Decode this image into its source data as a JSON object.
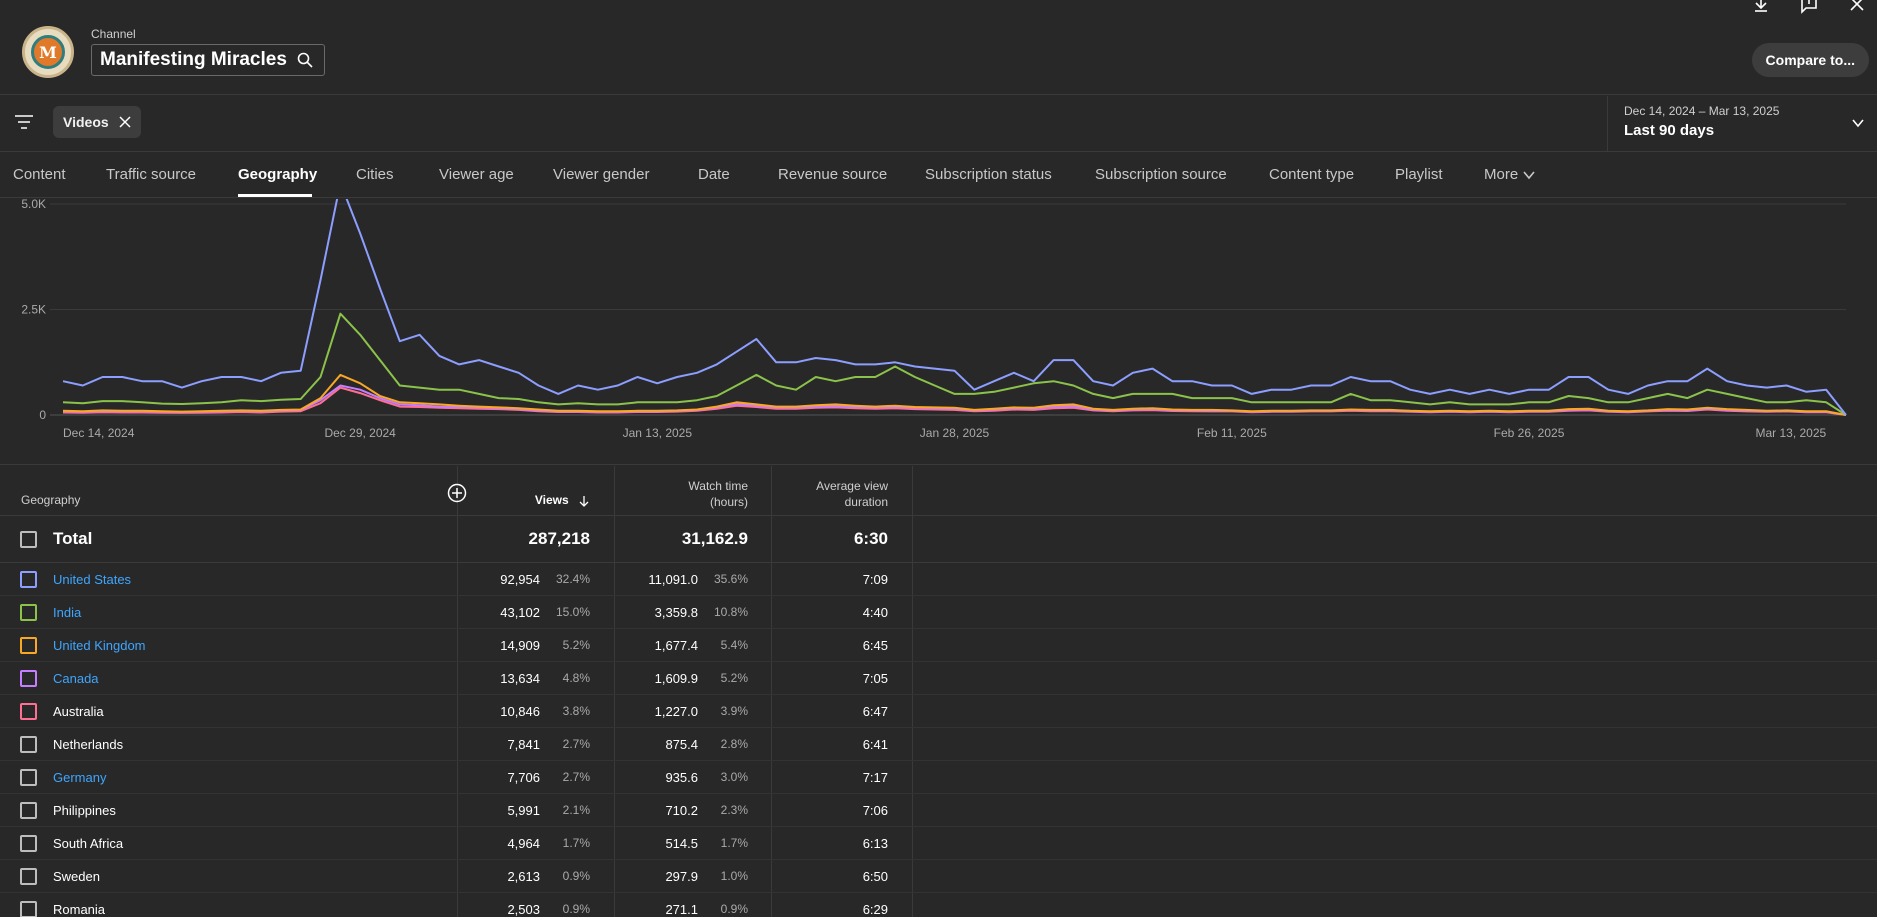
{
  "header": {
    "channel_label": "Channel",
    "channel_name": "Manifesting Miracles",
    "compare_label": "Compare to...",
    "avatar_letter": "M"
  },
  "filters": {
    "chip_label": "Videos",
    "date_range": "Dec 14, 2024 – Mar 13, 2025",
    "date_label": "Last 90 days"
  },
  "tabs": [
    {
      "label": "Content"
    },
    {
      "label": "Traffic source"
    },
    {
      "label": "Geography",
      "active": true
    },
    {
      "label": "Cities"
    },
    {
      "label": "Viewer age"
    },
    {
      "label": "Viewer gender"
    },
    {
      "label": "Date"
    },
    {
      "label": "Revenue source"
    },
    {
      "label": "Subscription status"
    },
    {
      "label": "Subscription source"
    },
    {
      "label": "Content type"
    },
    {
      "label": "Playlist"
    },
    {
      "label": "More"
    }
  ],
  "chart_data": {
    "type": "line",
    "y_ticks": [
      "5.0K",
      "2.5K",
      "0"
    ],
    "y_tick_values": [
      5000,
      2500,
      0
    ],
    "ylim": [
      0,
      5000
    ],
    "x_tick_labels": [
      "Dec 14, 2024",
      "Dec 29, 2024",
      "Jan 13, 2025",
      "Jan 28, 2025",
      "Feb 11, 2025",
      "Feb 26, 2025",
      "Mar 13, 2025"
    ],
    "x_tick_positions": [
      0,
      15,
      30,
      45,
      59,
      74,
      89
    ],
    "series": [
      {
        "name": "United States",
        "color": "#8c9eff",
        "values": [
          800,
          700,
          900,
          900,
          800,
          800,
          650,
          800,
          900,
          900,
          800,
          1000,
          1050,
          3200,
          5500,
          4300,
          3000,
          1750,
          1900,
          1400,
          1200,
          1300,
          1150,
          1000,
          700,
          500,
          700,
          600,
          700,
          900,
          750,
          900,
          1000,
          1200,
          1500,
          1800,
          1250,
          1250,
          1350,
          1300,
          1200,
          1200,
          1250,
          1150,
          1100,
          1050,
          600,
          800,
          1000,
          800,
          1300,
          1300,
          800,
          700,
          1000,
          1100,
          800,
          800,
          700,
          700,
          500,
          600,
          600,
          700,
          700,
          900,
          800,
          800,
          600,
          500,
          600,
          500,
          600,
          500,
          600,
          600,
          900,
          900,
          600,
          500,
          700,
          800,
          800,
          1100,
          800,
          700,
          650,
          700,
          550,
          600,
          0
        ]
      },
      {
        "name": "India",
        "color": "#8bc34a",
        "values": [
          300,
          280,
          330,
          330,
          300,
          270,
          260,
          280,
          300,
          350,
          330,
          360,
          380,
          900,
          2400,
          1900,
          1300,
          700,
          650,
          600,
          600,
          500,
          400,
          380,
          300,
          250,
          280,
          250,
          250,
          300,
          300,
          300,
          350,
          450,
          700,
          950,
          700,
          600,
          900,
          800,
          900,
          900,
          1150,
          900,
          700,
          500,
          500,
          550,
          650,
          750,
          800,
          700,
          500,
          400,
          500,
          500,
          500,
          400,
          400,
          400,
          300,
          300,
          300,
          300,
          300,
          500,
          350,
          350,
          300,
          250,
          300,
          250,
          250,
          250,
          300,
          300,
          450,
          400,
          300,
          300,
          400,
          500,
          400,
          600,
          500,
          400,
          300,
          300,
          350,
          300,
          0
        ]
      },
      {
        "name": "United Kingdom",
        "color": "#f9a825",
        "values": [
          100,
          90,
          110,
          100,
          100,
          90,
          80,
          90,
          100,
          110,
          100,
          120,
          130,
          400,
          950,
          750,
          450,
          300,
          280,
          250,
          220,
          200,
          180,
          160,
          130,
          100,
          100,
          90,
          90,
          100,
          100,
          110,
          130,
          200,
          300,
          250,
          200,
          200,
          230,
          250,
          220,
          200,
          220,
          190,
          180,
          170,
          120,
          150,
          180,
          170,
          230,
          250,
          150,
          120,
          150,
          160,
          130,
          120,
          120,
          110,
          90,
          100,
          100,
          110,
          110,
          130,
          120,
          120,
          100,
          90,
          100,
          90,
          100,
          90,
          100,
          100,
          140,
          150,
          100,
          90,
          110,
          140,
          130,
          170,
          140,
          120,
          100,
          110,
          90,
          90,
          0
        ]
      },
      {
        "name": "Canada",
        "color": "#c77dff",
        "values": [
          90,
          80,
          95,
          90,
          90,
          80,
          70,
          80,
          90,
          100,
          90,
          110,
          120,
          350,
          700,
          600,
          400,
          250,
          230,
          200,
          190,
          180,
          160,
          140,
          110,
          90,
          90,
          80,
          80,
          90,
          90,
          100,
          120,
          180,
          260,
          220,
          180,
          180,
          200,
          210,
          190,
          180,
          190,
          170,
          160,
          150,
          110,
          130,
          160,
          150,
          200,
          210,
          130,
          110,
          130,
          140,
          115,
          110,
          100,
          100,
          80,
          90,
          90,
          100,
          100,
          120,
          110,
          110,
          90,
          80,
          90,
          80,
          90,
          80,
          90,
          90,
          120,
          130,
          90,
          80,
          100,
          120,
          110,
          150,
          120,
          100,
          90,
          100,
          80,
          80,
          0
        ]
      },
      {
        "name": "Australia",
        "color": "#ff6f91",
        "values": [
          60,
          55,
          65,
          60,
          60,
          55,
          50,
          55,
          60,
          70,
          60,
          80,
          90,
          280,
          650,
          520,
          350,
          200,
          190,
          170,
          160,
          150,
          140,
          120,
          90,
          70,
          70,
          60,
          60,
          70,
          70,
          80,
          100,
          150,
          220,
          190,
          150,
          150,
          170,
          180,
          160,
          150,
          160,
          140,
          130,
          120,
          90,
          100,
          130,
          120,
          160,
          170,
          110,
          90,
          110,
          115,
          95,
          90,
          85,
          85,
          65,
          75,
          75,
          85,
          85,
          100,
          90,
          90,
          75,
          65,
          75,
          65,
          75,
          65,
          75,
          75,
          100,
          110,
          75,
          65,
          85,
          100,
          95,
          130,
          100,
          85,
          75,
          85,
          65,
          65,
          0
        ]
      }
    ]
  },
  "table": {
    "headers": {
      "geography": "Geography",
      "views": "Views",
      "watch_time_line1": "Watch time",
      "watch_time_line2": "(hours)",
      "avd_line1": "Average view",
      "avd_line2": "duration"
    },
    "total": {
      "label": "Total",
      "views": "287,218",
      "watch_time": "31,162.9",
      "avd": "6:30"
    },
    "rows": [
      {
        "country": "United States",
        "link": true,
        "color": "#8c9eff",
        "views": "92,954",
        "views_pct": "32.4%",
        "watch": "11,091.0",
        "watch_pct": "35.6%",
        "avd": "7:09"
      },
      {
        "country": "India",
        "link": true,
        "color": "#8bc34a",
        "views": "43,102",
        "views_pct": "15.0%",
        "watch": "3,359.8",
        "watch_pct": "10.8%",
        "avd": "4:40"
      },
      {
        "country": "United Kingdom",
        "link": true,
        "color": "#f9a825",
        "views": "14,909",
        "views_pct": "5.2%",
        "watch": "1,677.4",
        "watch_pct": "5.4%",
        "avd": "6:45"
      },
      {
        "country": "Canada",
        "link": true,
        "color": "#c77dff",
        "views": "13,634",
        "views_pct": "4.8%",
        "watch": "1,609.9",
        "watch_pct": "5.2%",
        "avd": "7:05"
      },
      {
        "country": "Australia",
        "link": false,
        "color": "#ff6f91",
        "views": "10,846",
        "views_pct": "3.8%",
        "watch": "1,227.0",
        "watch_pct": "3.9%",
        "avd": "6:47"
      },
      {
        "country": "Netherlands",
        "link": false,
        "color": "#bdbdbd",
        "views": "7,841",
        "views_pct": "2.7%",
        "watch": "875.4",
        "watch_pct": "2.8%",
        "avd": "6:41"
      },
      {
        "country": "Germany",
        "link": true,
        "color": "#bdbdbd",
        "views": "7,706",
        "views_pct": "2.7%",
        "watch": "935.6",
        "watch_pct": "3.0%",
        "avd": "7:17"
      },
      {
        "country": "Philippines",
        "link": false,
        "color": "#bdbdbd",
        "views": "5,991",
        "views_pct": "2.1%",
        "watch": "710.2",
        "watch_pct": "2.3%",
        "avd": "7:06"
      },
      {
        "country": "South Africa",
        "link": false,
        "color": "#bdbdbd",
        "views": "4,964",
        "views_pct": "1.7%",
        "watch": "514.5",
        "watch_pct": "1.7%",
        "avd": "6:13"
      },
      {
        "country": "Sweden",
        "link": false,
        "color": "#bdbdbd",
        "views": "2,613",
        "views_pct": "0.9%",
        "watch": "297.9",
        "watch_pct": "1.0%",
        "avd": "6:50"
      },
      {
        "country": "Romania",
        "link": false,
        "color": "#bdbdbd",
        "views": "2,503",
        "views_pct": "0.9%",
        "watch": "271.1",
        "watch_pct": "0.9%",
        "avd": "6:29"
      }
    ]
  }
}
